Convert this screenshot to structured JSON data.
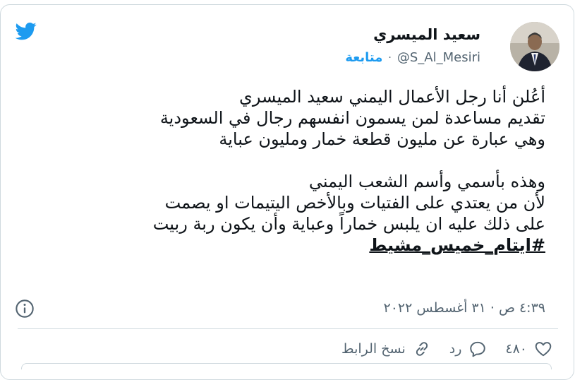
{
  "tweet": {
    "author_name": "سعيد الميسري",
    "handle": "@S_Al_Mesiri",
    "separator": "·",
    "follow_label": "متابعة",
    "lines": [
      "أعُلن أنا رجل الأعمال اليمني سعيد الميسري",
      "تقديم مساعدة لمن يسمون انفسهم رجال في السعودية",
      "وهي عبارة عن مليون قطعة خمار ومليون عباية",
      "",
      "وهذه بأسمي وأسم الشعب اليمني",
      "لأن من يعتدي على الفتيات وبالأخص اليتيمات او يصمت",
      "على ذلك عليه ان يلبس خماراً وعباية وأن يكون ربة ربيت"
    ],
    "hashtag": "#ايتام_خميس_مشيط",
    "timestamp": "٤:٣٩ ص · ٣١ أغسطس ٢٠٢٢",
    "likes_count": "٤٨٠",
    "reply_label": "رد",
    "copy_link_label": "نسخ الرابط"
  },
  "icons": {
    "logo": "twitter-bird-icon",
    "info": "info-icon",
    "like": "heart-icon",
    "reply": "reply-bubble-icon",
    "link": "link-icon"
  },
  "colors": {
    "brand": "#1d9bf0",
    "text": "#0f1419",
    "muted": "#536471",
    "border": "#cfd9de"
  }
}
